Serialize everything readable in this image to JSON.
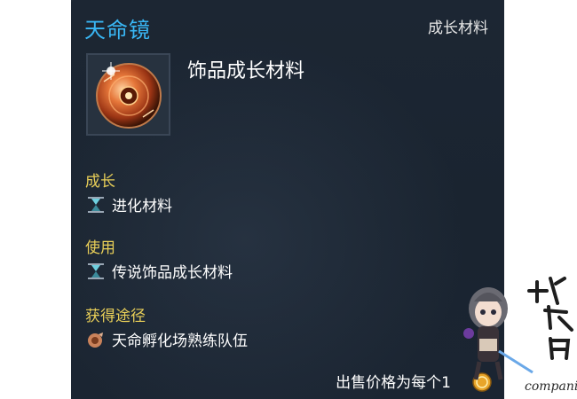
{
  "tooltip": {
    "item_name": "天命镜",
    "category": "成长材料",
    "item_type": "饰品成长材料",
    "sections": [
      {
        "title": "成长",
        "entries": [
          {
            "icon": "hourglass-icon",
            "text": "进化材料"
          }
        ]
      },
      {
        "title": "使用",
        "entries": [
          {
            "icon": "hourglass-icon",
            "text": "传说饰品成长材料"
          }
        ]
      },
      {
        "title": "获得途径",
        "entries": [
          {
            "icon": "dungeon-icon",
            "text": "天命孵化场熟练队伍"
          }
        ]
      }
    ],
    "sell_price": "出售价格为每个1"
  },
  "watermark": {
    "text": "companion"
  },
  "colors": {
    "item_name": "#39b7f5",
    "section_title": "#e9cf58",
    "background": "#1c2633"
  }
}
